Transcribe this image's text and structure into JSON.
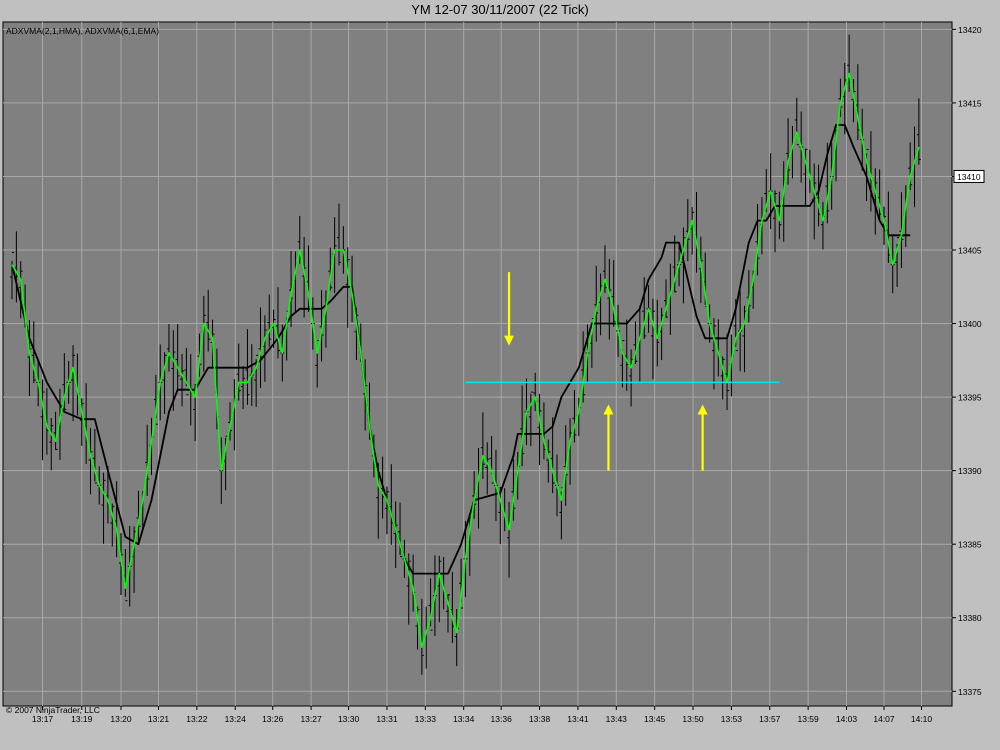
{
  "title": "YM 12-07  30/11/2007  (22 Tick)",
  "indicator_label": "ADXVMA(2,1,HMA), ADXVMA(6,1,EMA)",
  "copyright": "© 2007 NinjaTrader, LLC",
  "colors": {
    "background": "#c0c0c0",
    "plot_area": "#808080",
    "grid": "#a8a8a8",
    "bars": "#000000",
    "fast_ma": "#00ff00",
    "slow_ma": "#000000",
    "support_line": "#00e5ee",
    "arrows": "#ffff00",
    "price_marker_bg": "#ffffff"
  },
  "chart_data": {
    "type": "line",
    "ylim": [
      13374,
      13420.5
    ],
    "y_ticks": [
      13375,
      13380,
      13385,
      13390,
      13395,
      13400,
      13405,
      13410,
      13415,
      13420
    ],
    "x_range": [
      0,
      100
    ],
    "x_ticks": [
      {
        "x": 3.5,
        "label": "13:17"
      },
      {
        "x": 8.0,
        "label": "13:19"
      },
      {
        "x": 12.5,
        "label": "13:20"
      },
      {
        "x": 16.8,
        "label": "13:21"
      },
      {
        "x": 21.2,
        "label": "13:22"
      },
      {
        "x": 25.6,
        "label": "13:24"
      },
      {
        "x": 29.9,
        "label": "13:26"
      },
      {
        "x": 34.3,
        "label": "13:27"
      },
      {
        "x": 38.6,
        "label": "13:30"
      },
      {
        "x": 43.0,
        "label": "13:31"
      },
      {
        "x": 47.4,
        "label": "13:33"
      },
      {
        "x": 51.8,
        "label": "13:34"
      },
      {
        "x": 56.1,
        "label": "13:36"
      },
      {
        "x": 60.5,
        "label": "13:38"
      },
      {
        "x": 64.9,
        "label": "13:41"
      },
      {
        "x": 69.3,
        "label": "13:43"
      },
      {
        "x": 73.7,
        "label": "13:45"
      },
      {
        "x": 78.1,
        "label": "13:50"
      },
      {
        "x": 82.5,
        "label": "13:53"
      },
      {
        "x": 86.9,
        "label": "13:57"
      },
      {
        "x": 91.3,
        "label": "13:59"
      },
      {
        "x": 95.7,
        "label": "14:03"
      },
      {
        "x": 100.0,
        "label": "14:07"
      },
      {
        "x": 104.3,
        "label": "14:10"
      }
    ],
    "last_price": 13410,
    "series": [
      {
        "points": [
          [
            0,
            13404
          ],
          [
            1,
            13403
          ],
          [
            2,
            13398
          ],
          [
            3,
            13396
          ],
          [
            4,
            13393
          ],
          [
            5,
            13392
          ],
          [
            6,
            13395
          ],
          [
            7,
            13397
          ],
          [
            8,
            13394
          ],
          [
            9,
            13391
          ],
          [
            10,
            13389
          ],
          [
            11,
            13388
          ],
          [
            12,
            13386
          ],
          [
            13,
            13382
          ],
          [
            14,
            13385
          ],
          [
            15,
            13388
          ],
          [
            16,
            13392
          ],
          [
            17,
            13396
          ],
          [
            18,
            13398
          ],
          [
            19,
            13397
          ],
          [
            20,
            13396
          ],
          [
            21,
            13395
          ],
          [
            22,
            13400
          ],
          [
            23,
            13399
          ],
          [
            24,
            13390
          ],
          [
            25,
            13393
          ],
          [
            26,
            13396
          ],
          [
            27,
            13396
          ],
          [
            28,
            13397
          ],
          [
            29,
            13399
          ],
          [
            30,
            13400
          ],
          [
            31,
            13398
          ],
          [
            32,
            13402
          ],
          [
            33,
            13405
          ],
          [
            34,
            13402
          ],
          [
            35,
            13398
          ],
          [
            36,
            13401
          ],
          [
            37,
            13405
          ],
          [
            38,
            13405
          ],
          [
            39,
            13402
          ],
          [
            40,
            13398
          ],
          [
            41,
            13393
          ],
          [
            42,
            13389
          ],
          [
            43,
            13388
          ],
          [
            44,
            13386
          ],
          [
            45,
            13384
          ],
          [
            46,
            13382
          ],
          [
            47,
            13378
          ],
          [
            48,
            13380
          ],
          [
            49,
            13383
          ],
          [
            50,
            13381
          ],
          [
            51,
            13379
          ],
          [
            52,
            13384
          ],
          [
            53,
            13388
          ],
          [
            54,
            13391
          ],
          [
            55,
            13390
          ],
          [
            56,
            13388
          ],
          [
            57,
            13386
          ],
          [
            58,
            13390
          ],
          [
            59,
            13394
          ],
          [
            60,
            13395
          ],
          [
            61,
            13392
          ],
          [
            62,
            13390
          ],
          [
            63,
            13388
          ],
          [
            64,
            13392
          ],
          [
            65,
            13394
          ],
          [
            66,
            13398
          ],
          [
            67,
            13401
          ],
          [
            68,
            13403
          ],
          [
            69,
            13401
          ],
          [
            70,
            13398
          ],
          [
            71,
            13397
          ],
          [
            72,
            13399
          ],
          [
            73,
            13401
          ],
          [
            74,
            13399
          ],
          [
            75,
            13401
          ],
          [
            76,
            13403
          ],
          [
            77,
            13405
          ],
          [
            78,
            13407
          ],
          [
            79,
            13404
          ],
          [
            80,
            13400
          ],
          [
            81,
            13398
          ],
          [
            82,
            13396
          ],
          [
            83,
            13399
          ],
          [
            84,
            13400
          ],
          [
            85,
            13403
          ],
          [
            86,
            13407
          ],
          [
            87,
            13409
          ],
          [
            88,
            13407
          ],
          [
            89,
            13411
          ],
          [
            90,
            13413
          ],
          [
            91,
            13411
          ],
          [
            92,
            13409
          ],
          [
            93,
            13407
          ],
          [
            94,
            13410
          ],
          [
            95,
            13415
          ],
          [
            96,
            13417
          ],
          [
            97,
            13414
          ],
          [
            98,
            13411
          ],
          [
            99,
            13409
          ],
          [
            100,
            13407
          ],
          [
            101,
            13404
          ],
          [
            102,
            13406
          ],
          [
            103,
            13410
          ],
          [
            104,
            13412
          ]
        ]
      },
      {
        "points": [
          [
            0,
            13404
          ],
          [
            2,
            13399
          ],
          [
            4,
            13396
          ],
          [
            6,
            13394
          ],
          [
            8,
            13393.5
          ],
          [
            9.5,
            13393.5
          ],
          [
            11,
            13390
          ],
          [
            13,
            13385.5
          ],
          [
            14.5,
            13385
          ],
          [
            16,
            13388
          ],
          [
            18,
            13394
          ],
          [
            19,
            13395.5
          ],
          [
            21,
            13395.5
          ],
          [
            22.5,
            13397
          ],
          [
            24,
            13397
          ],
          [
            27,
            13397
          ],
          [
            28.5,
            13397.5
          ],
          [
            30.5,
            13399
          ],
          [
            32,
            13400.5
          ],
          [
            33,
            13401
          ],
          [
            35.5,
            13401
          ],
          [
            36.5,
            13401.5
          ],
          [
            38,
            13402.5
          ],
          [
            39,
            13402.5
          ],
          [
            40,
            13398
          ],
          [
            41,
            13393
          ],
          [
            42,
            13390
          ],
          [
            44,
            13386
          ],
          [
            45,
            13384
          ],
          [
            46,
            13383
          ],
          [
            49,
            13383
          ],
          [
            50,
            13383
          ],
          [
            51.5,
            13385
          ],
          [
            53,
            13388
          ],
          [
            56,
            13388.5
          ],
          [
            57.5,
            13391
          ],
          [
            58,
            13392.5
          ],
          [
            61,
            13392.5
          ],
          [
            62,
            13393
          ],
          [
            63,
            13395
          ],
          [
            65,
            13397
          ],
          [
            66.5,
            13400
          ],
          [
            70.5,
            13400
          ],
          [
            72,
            13401
          ],
          [
            73,
            13403
          ],
          [
            74.5,
            13404.5
          ],
          [
            75,
            13405.5
          ],
          [
            76.5,
            13405.5
          ],
          [
            77.5,
            13403
          ],
          [
            78.5,
            13400.5
          ],
          [
            79.5,
            13399
          ],
          [
            82,
            13399
          ],
          [
            83,
            13401
          ],
          [
            84.5,
            13405.5
          ],
          [
            85.5,
            13407
          ],
          [
            86.5,
            13407
          ],
          [
            87.5,
            13408
          ],
          [
            89.5,
            13408
          ],
          [
            91.5,
            13408
          ],
          [
            92.5,
            13409
          ],
          [
            93.5,
            13411.5
          ],
          [
            94.5,
            13413.5
          ],
          [
            95.5,
            13413.5
          ],
          [
            96.5,
            13412
          ],
          [
            98,
            13410
          ],
          [
            99.5,
            13407
          ],
          [
            100.5,
            13406
          ],
          [
            103,
            13406
          ]
        ]
      }
    ],
    "annotations": [
      {
        "type": "hline",
        "y": 13396,
        "x_start": 52,
        "x_end": 88
      },
      {
        "type": "arrow-down",
        "x": 57,
        "y_from": 13403.5,
        "y_to": 13398.5
      },
      {
        "type": "arrow-up",
        "x": 68.4,
        "y_from": 13390,
        "y_to": 13394.5
      },
      {
        "type": "arrow-up",
        "x": 79.2,
        "y_from": 13390,
        "y_to": 13394.5
      }
    ]
  }
}
